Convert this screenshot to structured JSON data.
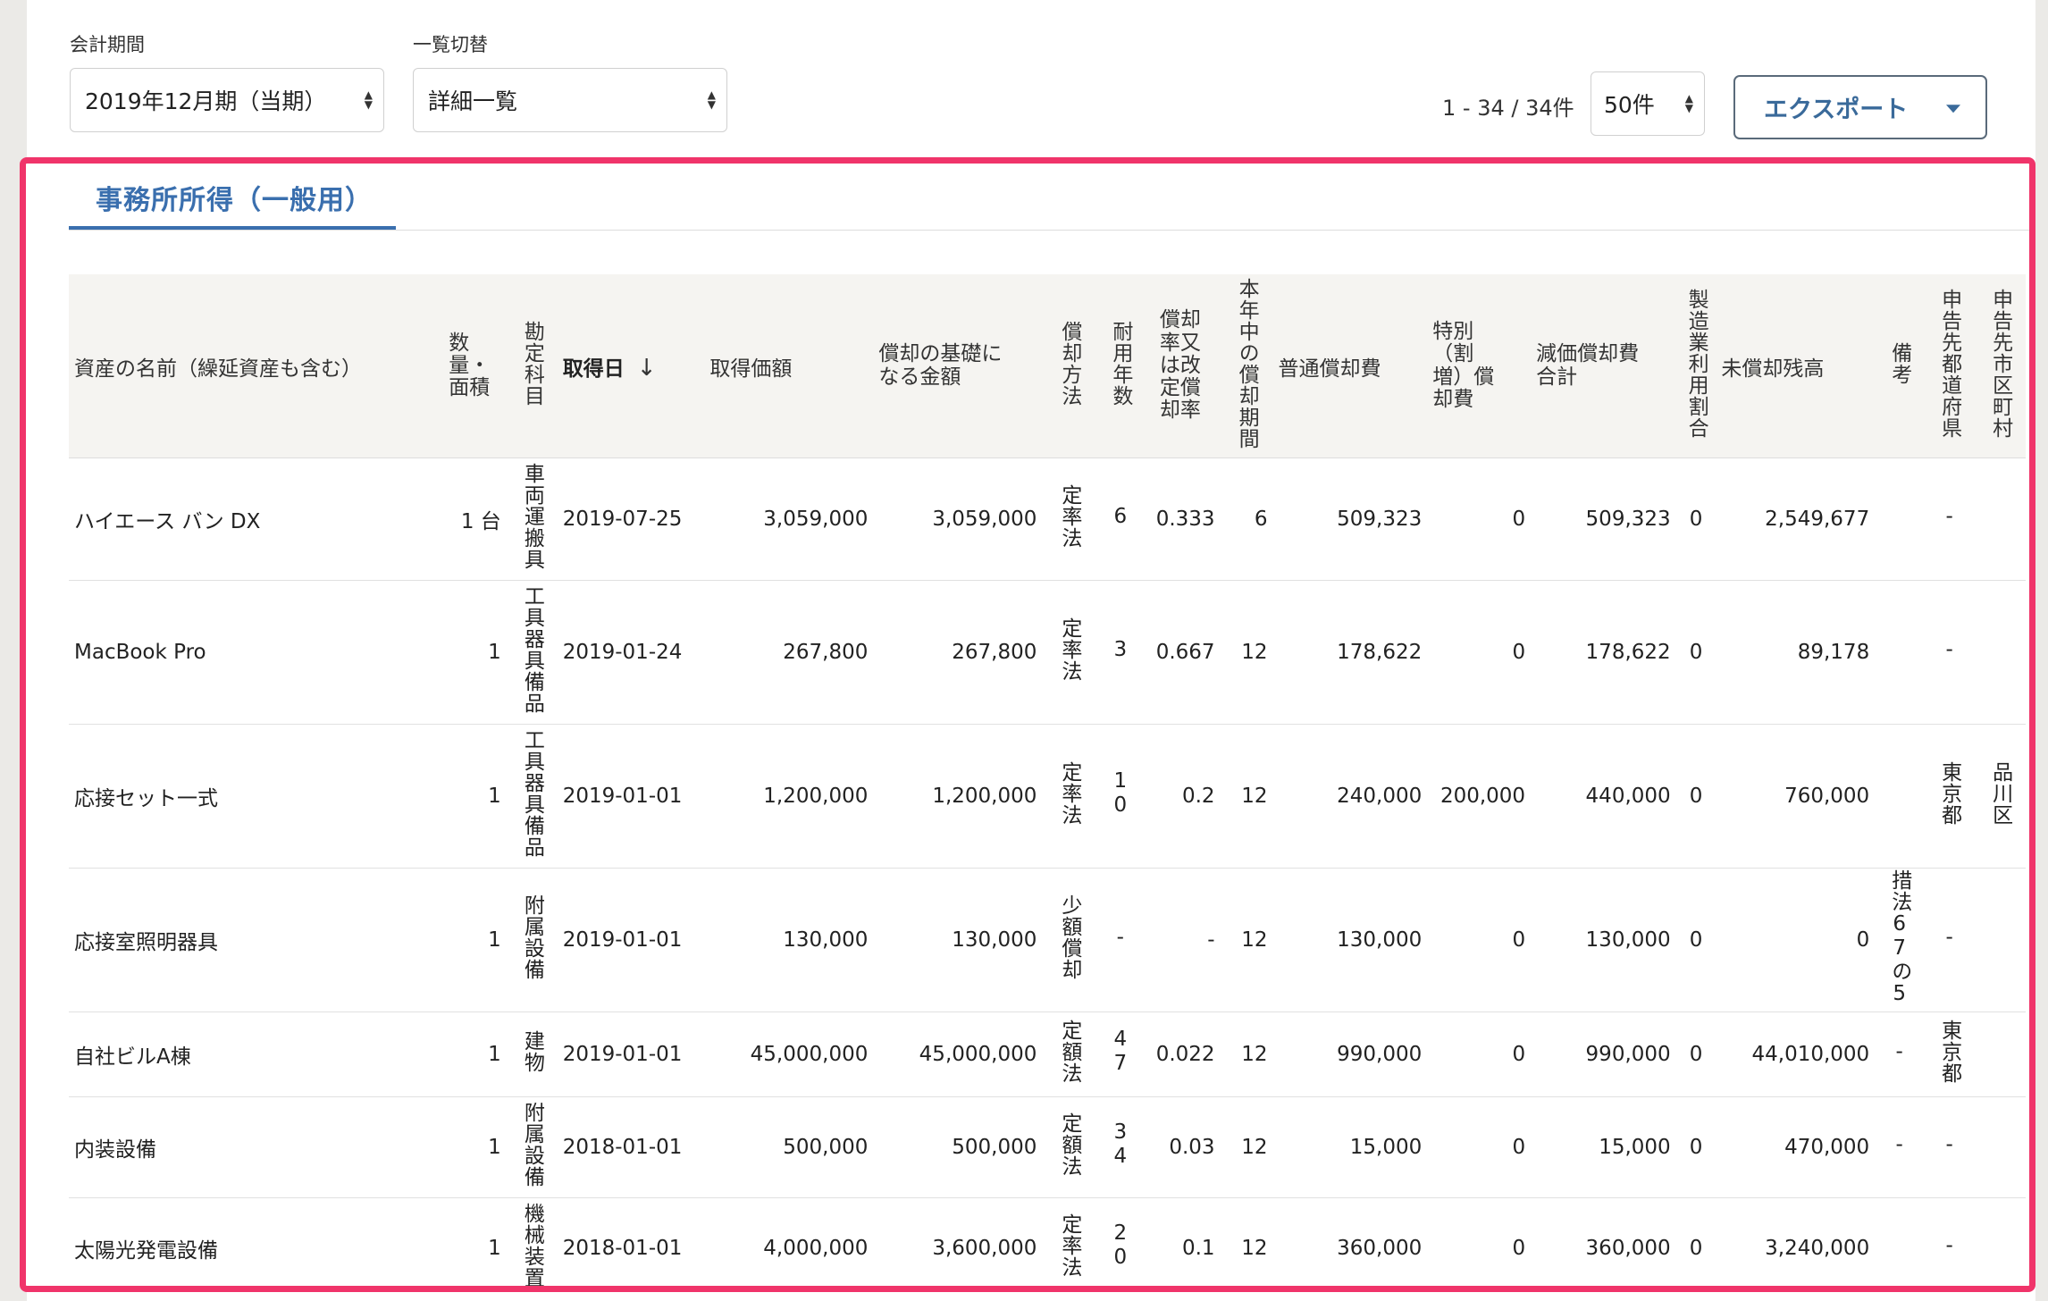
{
  "controls": {
    "period_label": "会計期間",
    "period_value": "2019年12月期（当期）",
    "view_label": "一覧切替",
    "view_value": "詳細一覧",
    "range_text": "1 - 34 / 34件",
    "per_page": "50件",
    "export_label": "エクスポート"
  },
  "section": {
    "title": "事務所所得（一般用）"
  },
  "table": {
    "headers": {
      "name": "資産の名前（繰延資産も含む）",
      "qty": "数量・面積",
      "account": "勘定科目",
      "date": "取得日",
      "cost": "取得価額",
      "basis": "償却の基礎になる金額",
      "method": "償却方法",
      "life": "耐用年数",
      "rate": "償却率又は改定償却率",
      "months": "本年中の償却期間",
      "normal": "普通償却費",
      "special": "特別（割増）償却費",
      "total": "減価償却費合計",
      "mfg": "製造業利用割合",
      "remaining": "未償却残高",
      "note": "備考",
      "pref": "申告先都道府県",
      "city": "申告先市区町村"
    },
    "rows": [
      {
        "name": "ハイエース バン DX",
        "qty": "1 台",
        "account": "車両運搬具",
        "date": "2019-07-25",
        "cost": "3,059,000",
        "basis": "3,059,000",
        "method": "定率法",
        "life": "6",
        "rate": "0.333",
        "months": "6",
        "normal": "509,323",
        "special": "0",
        "total": "509,323",
        "mfg": "0",
        "remaining": "2,549,677",
        "note": "",
        "pref": "-",
        "city": ""
      },
      {
        "name": "MacBook Pro",
        "qty": "1",
        "account": "工具器具備品",
        "date": "2019-01-24",
        "cost": "267,800",
        "basis": "267,800",
        "method": "定率法",
        "life": "3",
        "rate": "0.667",
        "months": "12",
        "normal": "178,622",
        "special": "0",
        "total": "178,622",
        "mfg": "0",
        "remaining": "89,178",
        "note": "",
        "pref": "-",
        "city": ""
      },
      {
        "name": "応接セット一式",
        "qty": "1",
        "account": "工具器具備品",
        "date": "2019-01-01",
        "cost": "1,200,000",
        "basis": "1,200,000",
        "method": "定率法",
        "life": "10",
        "rate": "0.2",
        "months": "12",
        "normal": "240,000",
        "special": "200,000",
        "total": "440,000",
        "mfg": "0",
        "remaining": "760,000",
        "note": "",
        "pref": "東京都",
        "city": "品川区"
      },
      {
        "name": "応接室照明器具",
        "qty": "1",
        "account": "附属設備",
        "date": "2019-01-01",
        "cost": "130,000",
        "basis": "130,000",
        "method": "少額償却",
        "life": "-",
        "rate": "-",
        "months": "12",
        "normal": "130,000",
        "special": "0",
        "total": "130,000",
        "mfg": "0",
        "remaining": "0",
        "note": "措法67の5",
        "pref": "-",
        "city": ""
      },
      {
        "name": "自社ビルA棟",
        "qty": "1",
        "account": "建物",
        "date": "2019-01-01",
        "cost": "45,000,000",
        "basis": "45,000,000",
        "method": "定額法",
        "life": "47",
        "rate": "0.022",
        "months": "12",
        "normal": "990,000",
        "special": "0",
        "total": "990,000",
        "mfg": "0",
        "remaining": "44,010,000",
        "note": "-",
        "pref": "東京都",
        "city": ""
      },
      {
        "name": "内装設備",
        "qty": "1",
        "account": "附属設備",
        "date": "2018-01-01",
        "cost": "500,000",
        "basis": "500,000",
        "method": "定額法",
        "life": "34",
        "rate": "0.03",
        "months": "12",
        "normal": "15,000",
        "special": "0",
        "total": "15,000",
        "mfg": "0",
        "remaining": "470,000",
        "note": "-",
        "pref": "-",
        "city": ""
      },
      {
        "name": "太陽光発電設備",
        "qty": "1",
        "account": "機械装置",
        "date": "2018-01-01",
        "cost": "4,000,000",
        "basis": "3,600,000",
        "method": "定率法",
        "life": "20",
        "rate": "0.1",
        "months": "12",
        "normal": "360,000",
        "special": "0",
        "total": "360,000",
        "mfg": "0",
        "remaining": "3,240,000",
        "note": "",
        "pref": "-",
        "city": ""
      }
    ]
  }
}
